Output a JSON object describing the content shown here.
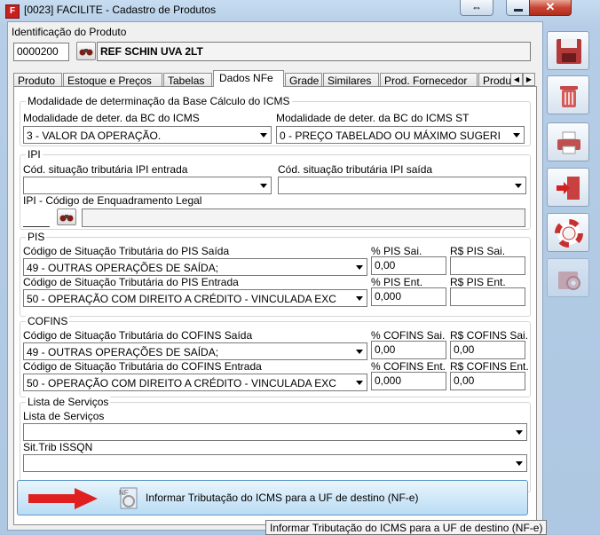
{
  "window": {
    "app_icon": "F",
    "title": "[0023] FACILITE - Cadastro de Produtos",
    "swap_icon": "⇔",
    "close_icon": "✕"
  },
  "identification": {
    "caption": "Identificação do Produto",
    "code": "0000200",
    "name": "REF SCHIN UVA 2LT"
  },
  "tabs": [
    {
      "label": "Produto"
    },
    {
      "label": "Estoque e Preços"
    },
    {
      "label": "Tabelas"
    },
    {
      "label": "Dados NFe"
    },
    {
      "label": "Grade"
    },
    {
      "label": "Similares"
    },
    {
      "label": "Prod. Fornecedor"
    },
    {
      "label": "Produ"
    }
  ],
  "tab_scroll": {
    "left": "◀",
    "right": "▶"
  },
  "icms": {
    "caption": "Modalidade de determinação da Base Cálculo do ICMS",
    "bc_label": "Modalidade de deter. da BC do ICMS",
    "bc_value": "3 - VALOR DA OPERAÇÃO.",
    "bcst_label": "Modalidade de deter. da BC do ICMS ST",
    "bcst_value": "0 - PREÇO TABELADO OU MÁXIMO SUGERI"
  },
  "ipi": {
    "caption": "IPI",
    "in_label": "Cód. situação tributária IPI entrada",
    "in_value": "",
    "out_label": "Cód. situação tributária IPI saída",
    "out_value": "",
    "enq_label": "IPI - Código de Enquadramento Legal",
    "enq_code": "",
    "enq_desc": ""
  },
  "pis": {
    "caption": "PIS",
    "out_label": "Código de Situação Tributária do PIS Saída",
    "out_value": "49 - OUTRAS OPERAÇÕES DE SAÍDA;",
    "out_pct_label": "% PIS Sai.",
    "out_pct": "0,00",
    "out_rs_label": "R$ PIS Sai.",
    "out_rs": "",
    "in_label": "Código de Situação Tributária do PIS Entrada",
    "in_value": "50 - OPERAÇÃO COM DIREITO  A CRÉDITO  - VINCULADA EXC",
    "in_pct_label": "% PIS Ent.",
    "in_pct": "0,000",
    "in_rs_label": "R$ PIS Ent.",
    "in_rs": ""
  },
  "cofins": {
    "caption": "COFINS",
    "out_label": "Código de Situação Tributária do COFINS Saída",
    "out_value": "49 - OUTRAS OPERAÇÕES DE SAÍDA;",
    "out_pct_label": "% COFINS Sai.",
    "out_pct": "0,00",
    "out_rs_label": "R$ COFINS Sai.",
    "out_rs": "0,00",
    "in_label": "Código de Situação Tributária do COFINS Entrada",
    "in_value": "50 - OPERAÇÃO COM DIREITO  A CRÉDITO  - VINCULADA EXC",
    "in_pct_label": "% COFINS Ent.",
    "in_pct": "0,000",
    "in_rs_label": "R$ COFINS Ent.",
    "in_rs": "0,00"
  },
  "servicos": {
    "caption": "Lista de Serviços",
    "list_label": "Lista de Serviços",
    "list_value": "",
    "issqn_label": "Sit.Trib ISSQN",
    "issqn_value": ""
  },
  "icms_uf_button": {
    "label": "Informar Tributação do ICMS para a UF de destino (NF-e)",
    "tooltip": "Informar Tributação do ICMS para a UF de destino (NF-e)"
  },
  "side_buttons": [
    {
      "name": "save",
      "icon": "floppy-disk-icon"
    },
    {
      "name": "delete",
      "icon": "trash-icon"
    },
    {
      "name": "print",
      "icon": "printer-icon"
    },
    {
      "name": "exit",
      "icon": "exit-door-icon"
    },
    {
      "name": "help",
      "icon": "lifebuoy-icon"
    },
    {
      "name": "settings",
      "icon": "gear-icon"
    }
  ],
  "colors": {
    "window_frame": "#b5cde6",
    "close_button": "#c84535",
    "arrow_red": "#e02020",
    "big_button": "#b9dcf4"
  }
}
